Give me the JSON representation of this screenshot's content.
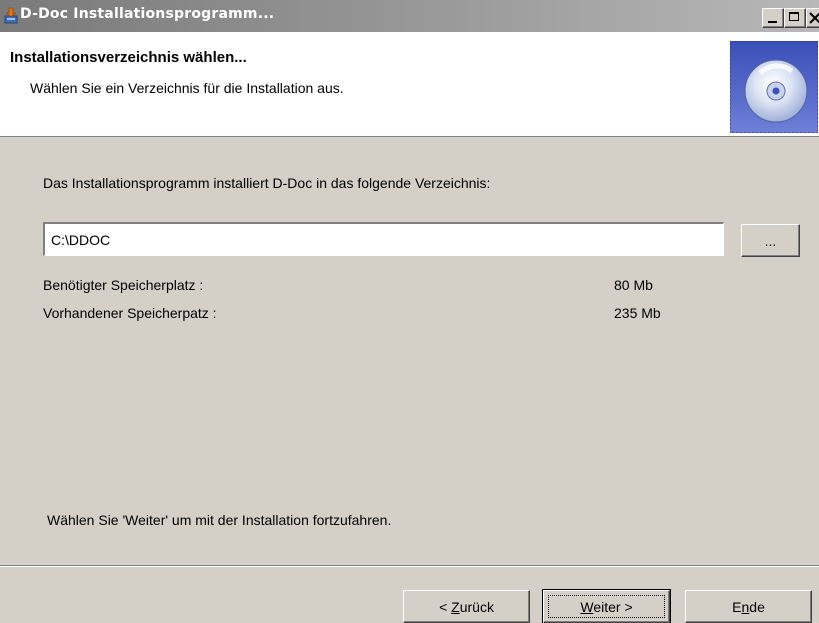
{
  "window": {
    "title": "D-Doc Installationsprogramm...",
    "app_icon": "installer-icon"
  },
  "header": {
    "title": "Installationsverzeichnis wählen...",
    "subtitle": "Wählen Sie ein Verzeichnis für die Installation aus.",
    "icon": "cd-disc-icon"
  },
  "body": {
    "intro": "Das Installationsprogramm installiert D-Doc in das folgende Verzeichnis:",
    "path_value": "C:\\DDOC",
    "browse_label": "...",
    "required_label": "Benötigter Speicherplatz :",
    "required_value": "80 Mb",
    "available_label": "Vorhandener Speicherpatz :",
    "available_value": "235 Mb",
    "hint": "Wählen Sie 'Weiter' um mit der Installation fortzufahren."
  },
  "buttons": {
    "back_prefix": "< ",
    "back_mnemonic": "Z",
    "back_rest": "urück",
    "next_mnemonic": "W",
    "next_rest": "eiter >",
    "end_first": "E",
    "end_mnemonic": "n",
    "end_rest": "de"
  },
  "colors": {
    "titlebar": "#8a8a8a",
    "face": "#d4d0c8"
  }
}
